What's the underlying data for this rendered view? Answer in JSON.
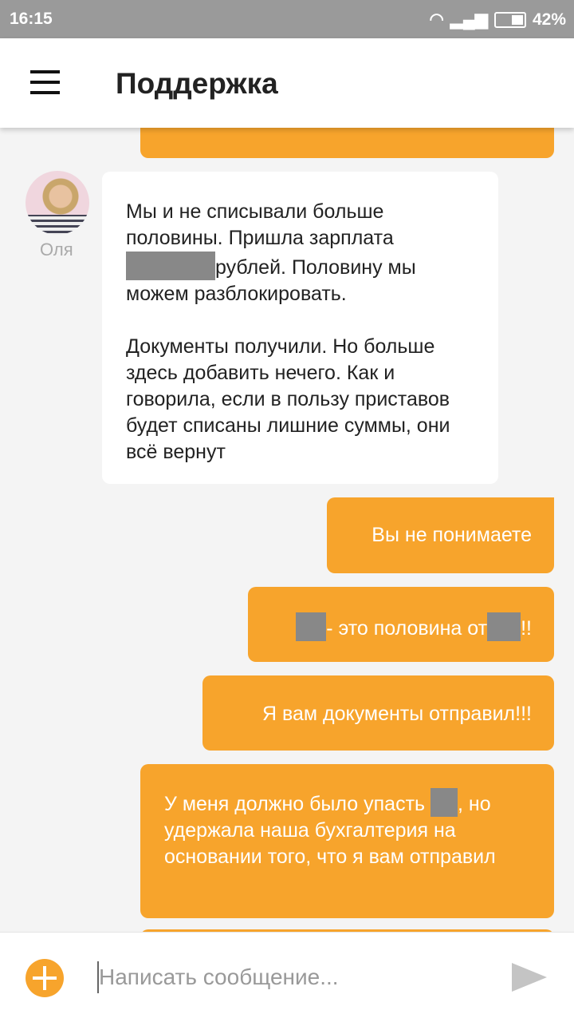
{
  "status": {
    "time": "16:15",
    "battery": "42%"
  },
  "header": {
    "title": "Поддержка"
  },
  "colors": {
    "accent": "#f7a42c",
    "status_bar": "#9a9a9a"
  },
  "messages": {
    "incoming": {
      "sender": "Оля",
      "p1a": "Мы и не списывали больше половины. Пришла зарплата",
      "p1b": "рублей. Половину мы можем разблокировать.",
      "p2": "Документы получили. Но больше здесь добавить нечего. Как и говорила, если в пользу приставов будет списаны лишние суммы, они всё вернут"
    },
    "out1": "Вы не понимаете",
    "out2a": "- это половина от",
    "out2b": "!!",
    "out3": "Я вам документы отправил!!!",
    "out4a": "У меня должно было упасть",
    "out4b": ", но удержала наша бухгалтерия на основании того, что я вам отправил"
  },
  "composer": {
    "placeholder": "Написать сообщение..."
  }
}
